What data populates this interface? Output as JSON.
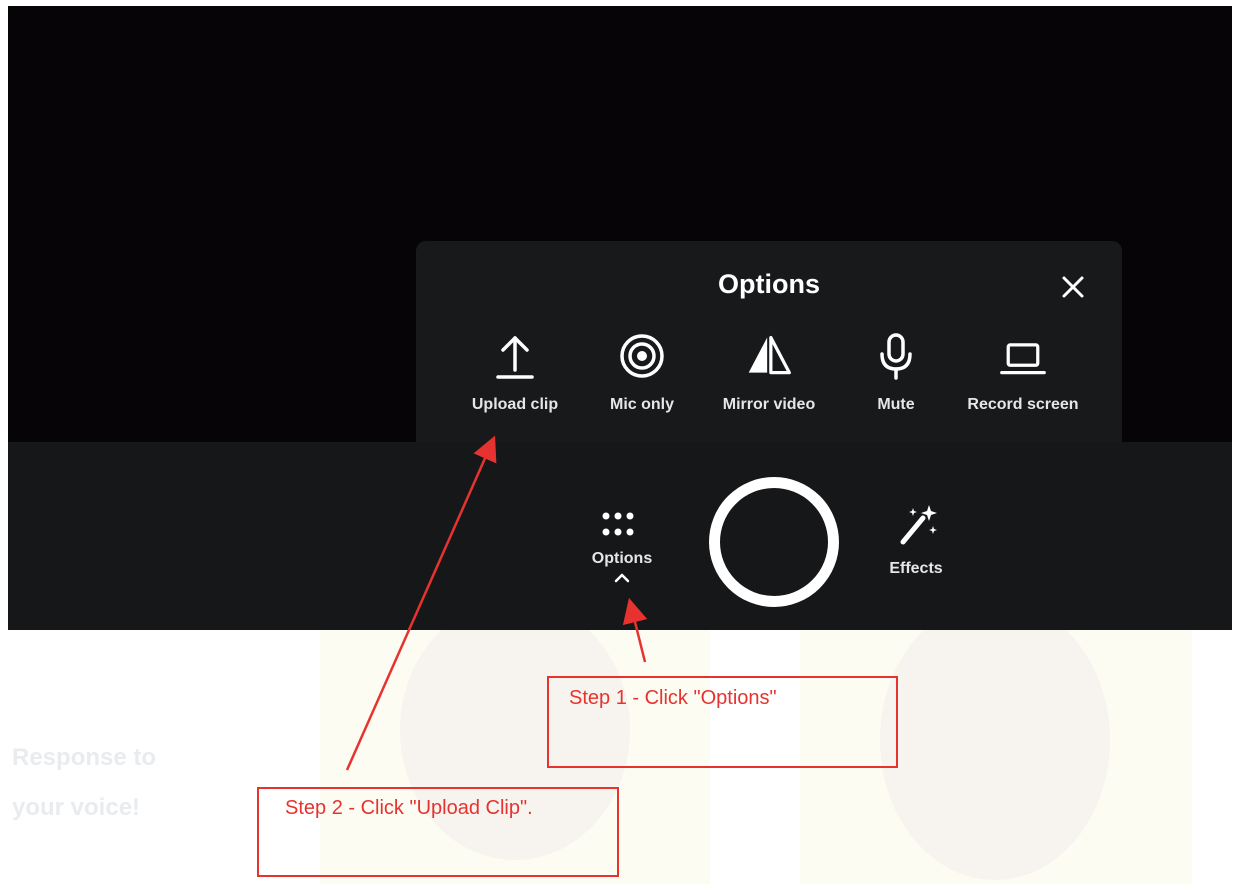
{
  "options_panel": {
    "title": "Options",
    "close_icon": "close-icon",
    "items": [
      {
        "label": "Upload clip",
        "icon": "upload-icon"
      },
      {
        "label": "Mic only",
        "icon": "mic-only-icon"
      },
      {
        "label": "Mirror video",
        "icon": "mirror-icon"
      },
      {
        "label": "Mute",
        "icon": "microphone-icon"
      },
      {
        "label": "Record screen",
        "icon": "laptop-icon"
      }
    ]
  },
  "control_bar": {
    "options_label": "Options",
    "effects_label": "Effects"
  },
  "background_page": {
    "line1": "Response to",
    "line2": "your voice!"
  },
  "annotations": {
    "step1": "Step 1 - Click \"Options\"",
    "step2": "Step 2 - Click \"Upload Clip\"."
  },
  "colors": {
    "annotation": "#e6332f",
    "video_bg": "#060406",
    "bar_bg": "#161719"
  }
}
